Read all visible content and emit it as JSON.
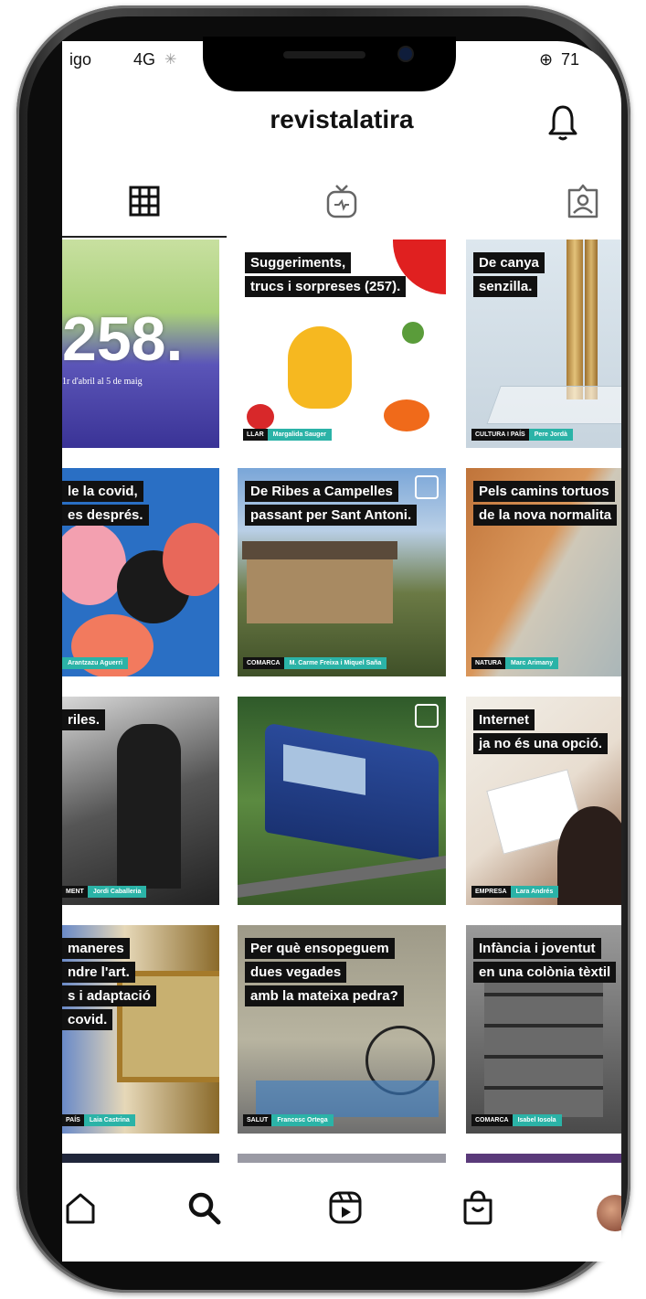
{
  "status_bar": {
    "carrier": "igo",
    "network": "4G",
    "battery": "71"
  },
  "header": {
    "username": "revistalatira"
  },
  "icons": {
    "bell": "bell-icon",
    "grid": "grid-icon",
    "igtv": "igtv-icon",
    "tagged": "tagged-icon",
    "home": "home-icon",
    "search": "search-icon",
    "reels": "reels-icon",
    "shop": "shop-icon"
  },
  "posts": [
    {
      "lines": [
        "258."
      ],
      "footer": "1r d'abril al 5 de maig",
      "section": "",
      "author": ""
    },
    {
      "lines": [
        "Suggeriments,",
        "trucs i sorpreses (257)."
      ],
      "section": "LLAR",
      "author": "Margalida Sauger"
    },
    {
      "lines": [
        "De canya",
        "senzilla."
      ],
      "section": "CULTURA I PAÍS",
      "author": "Pere Jordà"
    },
    {
      "lines": [
        "le la covid,",
        "es després."
      ],
      "section": "",
      "author": "Arantzazu Aguerri"
    },
    {
      "lines": [
        "De Ribes a Campelles",
        "passant per Sant Antoni."
      ],
      "section": "COMARCA",
      "author": "M. Carme Freixa i Miquel Saña"
    },
    {
      "lines": [
        "Pels camins tortuos",
        "de la nova normalita"
      ],
      "section": "NATURA",
      "author": "Marc Arimany"
    },
    {
      "lines": [
        "riles."
      ],
      "section": "MENT",
      "author": "Jordi Caballeria"
    },
    {
      "lines": [],
      "section": "",
      "author": ""
    },
    {
      "lines": [
        "Internet",
        "ja no és una opció."
      ],
      "section": "EMPRESA",
      "author": "Lara Andrés"
    },
    {
      "lines": [
        "maneres",
        "ndre l'art.",
        "s i adaptació",
        "covid."
      ],
      "section": "PAÍS",
      "author": "Laia Castrina"
    },
    {
      "lines": [
        "Per què ensopeguem",
        "dues vegades",
        "amb la mateixa pedra?"
      ],
      "section": "SALUT",
      "author": "Francesc Ortega"
    },
    {
      "lines": [
        "Infància i joventut",
        "en una colònia tèxtil"
      ],
      "section": "COMARCA",
      "author": "Isabel Iosola"
    }
  ],
  "colors": {
    "teal": "#2bb3a7",
    "black": "#111111"
  }
}
